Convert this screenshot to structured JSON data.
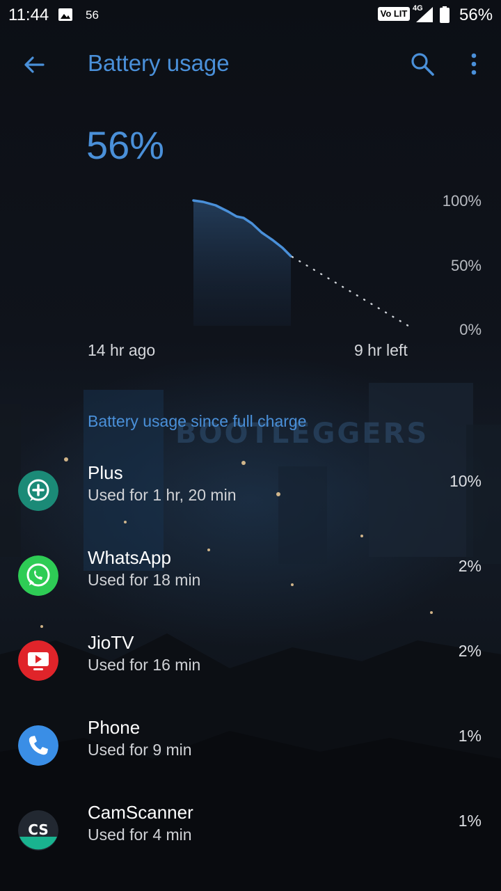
{
  "status_bar": {
    "time": "11:44",
    "notification_count": "56",
    "volte": "Vo LIT",
    "network": "4G",
    "battery_percent": "56%"
  },
  "app_bar": {
    "title": "Battery usage",
    "back_icon": "arrow-back-icon",
    "search_icon": "search-icon",
    "more_icon": "more-vert-icon"
  },
  "battery": {
    "level": "56%"
  },
  "chart": {
    "y_labels": [
      "100%",
      "50%",
      "0%"
    ],
    "x_start": "14 hr ago",
    "x_end": "9 hr left",
    "accent": "#4a90d9"
  },
  "usage": {
    "header": "Battery usage since full charge",
    "watermark": "BOOTLEGGERS",
    "items": [
      {
        "name": "Plus",
        "usage": "Used for 1 hr, 20 min",
        "percent": "10%",
        "icon": "plus-app-icon"
      },
      {
        "name": "WhatsApp",
        "usage": "Used for 18 min",
        "percent": "2%",
        "icon": "whatsapp-icon"
      },
      {
        "name": "JioTV",
        "usage": "Used for 16 min",
        "percent": "2%",
        "icon": "jiotv-icon"
      },
      {
        "name": "Phone",
        "usage": "Used for 9 min",
        "percent": "1%",
        "icon": "phone-icon"
      },
      {
        "name": "CamScanner",
        "usage": "Used for 4 min",
        "percent": "1%",
        "icon": "camscanner-icon"
      }
    ]
  }
}
